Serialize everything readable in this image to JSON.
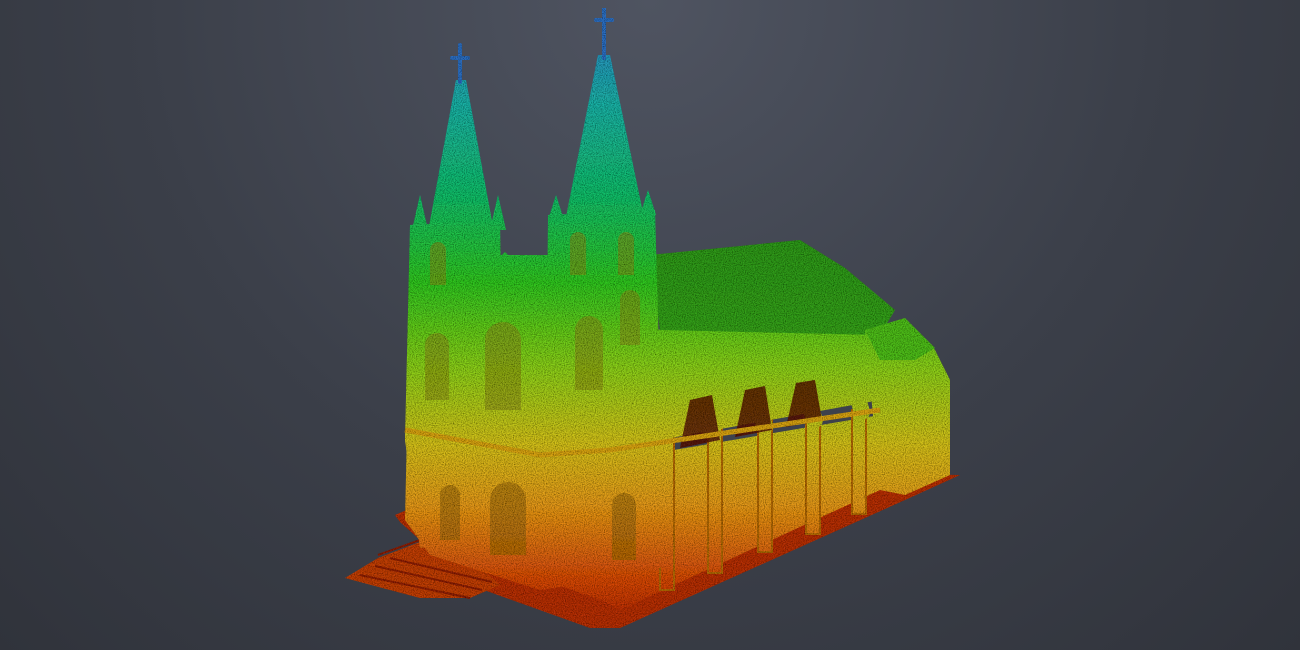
{
  "viewer": {
    "background_top": "#4f5461",
    "background_bottom": "#30333b"
  },
  "point_cloud": {
    "subject": "gothic-church-with-twin-spires",
    "color_scheme": "height-ramp",
    "color_ramp": [
      "#b0240c",
      "#d84a10",
      "#e79a1a",
      "#d6c31e",
      "#8fd21c",
      "#32c822",
      "#17c06a",
      "#1fb3a8",
      "#2f7fd0"
    ],
    "parts": [
      "ground-slab",
      "entrance-platform",
      "nave-walls",
      "nave-roof",
      "flying-buttresses",
      "apse",
      "facade",
      "left-tower",
      "right-tower",
      "left-spire",
      "right-spire",
      "spire-crosses"
    ]
  }
}
